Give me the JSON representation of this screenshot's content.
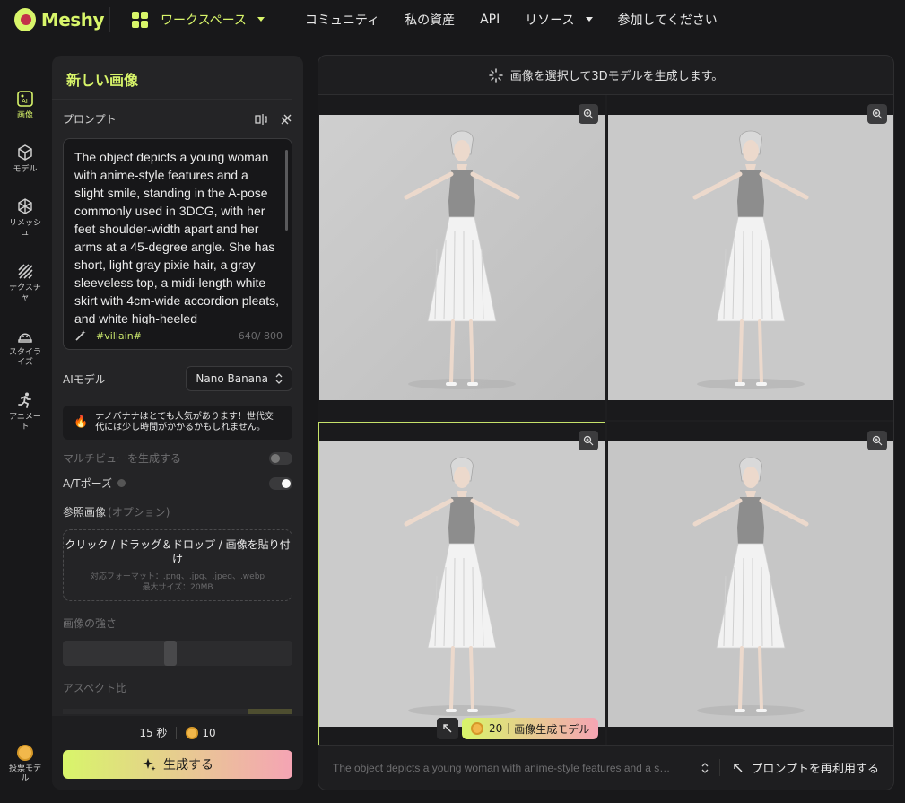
{
  "app": {
    "logo_text": "Meshy"
  },
  "nav": {
    "workspace": "ワークスペース",
    "community": "コミュニティ",
    "assets": "私の資産",
    "api": "API",
    "resources": "リソース",
    "join": "参加してください"
  },
  "rail": {
    "image": "画像",
    "model": "モデル",
    "remesh": "リメッシュ",
    "texture": "テクスチャ",
    "stylize": "スタイライズ",
    "animate": "アニメート",
    "vote": "投票モデル"
  },
  "panel": {
    "title": "新しい画像",
    "prompt_label": "プロンプト",
    "prompt_text": "The object depicts a young woman with anime-style features and a slight smile, standing in the A-pose commonly used in 3DCG, with her feet shoulder-width apart and her arms at a 45-degree angle. She has short, light gray pixie hair, a gray sleeveless top, a midi-length white skirt with 4cm-wide accordion pleats, and white high-heeled",
    "tag": "#villain#",
    "counter": "640/ 800",
    "ai_model_label": "AIモデル",
    "ai_model_value": "Nano Banana",
    "notice": "ナノバナナはとても人気があります！世代交代には少し時間がかかるかもしれません。",
    "multiview_label": "マルチビューを生成する",
    "pose_label": "A/Tポーズ",
    "ref_label": "参照画像",
    "ref_optional": "(オプション)",
    "drop_main": "クリック / ドラッグ＆ドロップ / 画像を貼り付け",
    "drop_formats": "対応フォーマット：.png、.jpg、.jpeg、.webp",
    "drop_size": "最大サイズ：20MB",
    "strength_label": "画像の強さ",
    "strength_value": 0.45,
    "aspect_label": "アスペクト比",
    "time": "15 秒",
    "credits": "10",
    "generate": "生成する"
  },
  "gallery": {
    "header": "画像を選択して3Dモデルを生成します。",
    "badge_credits": "20",
    "badge_label": "画像生成モデル",
    "footer_prompt": "The object depicts a young woman with anime-style features and a s…",
    "reuse": "プロンプトを再利用する"
  },
  "colors": {
    "accent": "#d8f56a",
    "pink": "#f5a4b4",
    "bg": "#18181a"
  }
}
